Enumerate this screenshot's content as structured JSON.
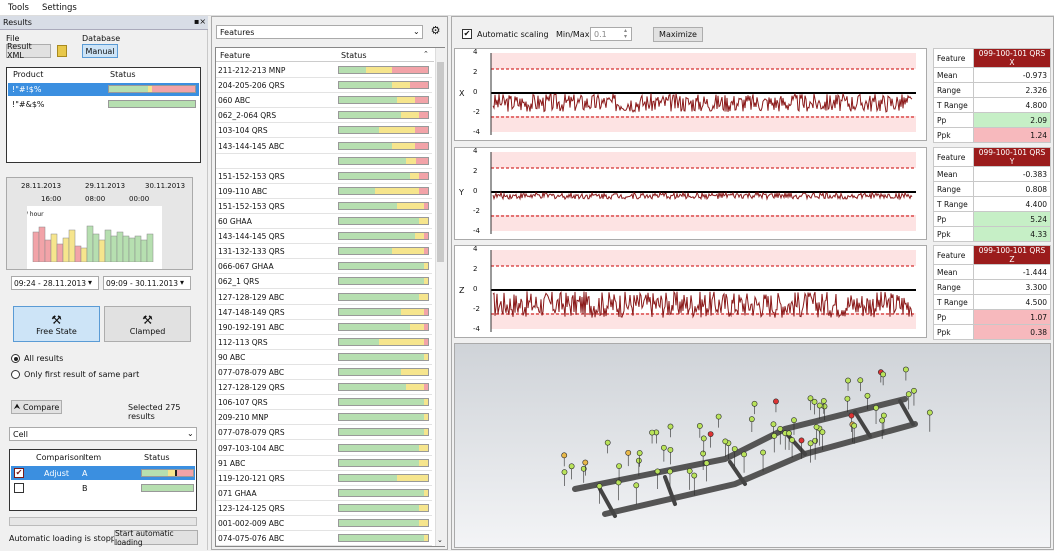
{
  "menu": {
    "tools": "Tools",
    "settings": "Settings"
  },
  "results": {
    "header": "Results",
    "file_label": "File",
    "database_label": "Database",
    "result_xml": "Result XML",
    "manual": "Manual",
    "products_headers": [
      "Product",
      "Status"
    ],
    "products": [
      {
        "name": "!\"#!$%",
        "status": [
          [
            0.45,
            "g"
          ],
          [
            0.05,
            "y"
          ],
          [
            0.5,
            "r"
          ]
        ]
      },
      {
        "name": "!\"#&$%",
        "status": [
          [
            1,
            "g"
          ]
        ]
      }
    ],
    "dates": [
      "28.11.2013",
      "29.11.2013",
      "30.11.2013"
    ],
    "times": [
      "16:00",
      "08:00",
      "00:00"
    ],
    "parts_label": "Parts / hour",
    "y_ticks": [
      "20",
      "10",
      "0"
    ],
    "from": "09:24 - 28.11.2013",
    "to": "09:09 - 30.11.2013",
    "free_state": "Free State",
    "clamped": "Clamped",
    "radio_all": "All results",
    "radio_first": "Only first result of same part",
    "compare": "Compare",
    "selected": "Selected 275 results",
    "cell": "Cell",
    "cmp_headers": [
      "Comparison",
      "Item",
      "Status"
    ],
    "cmp_rows": [
      {
        "name": "Adjust",
        "item": "A"
      },
      {
        "name": "",
        "item": "B"
      }
    ],
    "auto_loading_text": "Automatic loading is stopped",
    "start_auto": "Start automatic loading"
  },
  "features": {
    "dropdown": "Features",
    "headers": [
      "Feature",
      "Status"
    ],
    "rows": [
      {
        "name": "211-212-213 MNP",
        "s": [
          [
            0.3,
            "g"
          ],
          [
            0.3,
            "y"
          ],
          [
            0.4,
            "r"
          ]
        ]
      },
      {
        "name": "204-205-206 QRS",
        "s": [
          [
            0.6,
            "g"
          ],
          [
            0.2,
            "y"
          ],
          [
            0.2,
            "r"
          ]
        ]
      },
      {
        "name": "060 ABC",
        "s": [
          [
            0.65,
            "g"
          ],
          [
            0.2,
            "y"
          ],
          [
            0.15,
            "r"
          ]
        ]
      },
      {
        "name": "062_2-064 QRS",
        "s": [
          [
            0.7,
            "g"
          ],
          [
            0.2,
            "y"
          ],
          [
            0.1,
            "r"
          ]
        ]
      },
      {
        "name": "103-104 QRS",
        "s": [
          [
            0.45,
            "g"
          ],
          [
            0.4,
            "y"
          ],
          [
            0.15,
            "r"
          ]
        ]
      },
      {
        "name": "143-144-145 ABC",
        "s": [
          [
            0.6,
            "g"
          ],
          [
            0.25,
            "y"
          ],
          [
            0.15,
            "r"
          ]
        ]
      },
      {
        "name": "099-100-101 QRS",
        "s": [
          [
            0.75,
            "g"
          ],
          [
            0.12,
            "y"
          ],
          [
            0.13,
            "r"
          ]
        ]
      },
      {
        "name": "151-152-153 QRS",
        "s": [
          [
            0.8,
            "g"
          ],
          [
            0.1,
            "y"
          ],
          [
            0.1,
            "r"
          ]
        ]
      },
      {
        "name": "109-110 ABC",
        "s": [
          [
            0.4,
            "g"
          ],
          [
            0.5,
            "y"
          ],
          [
            0.1,
            "r"
          ]
        ]
      },
      {
        "name": "151-152-153 QRS",
        "s": [
          [
            0.65,
            "g"
          ],
          [
            0.3,
            "y"
          ],
          [
            0.05,
            "r"
          ]
        ]
      },
      {
        "name": "60 GHAA",
        "s": [
          [
            0.9,
            "g"
          ],
          [
            0.1,
            "y"
          ]
        ]
      },
      {
        "name": "143-144-145 QRS",
        "s": [
          [
            0.85,
            "g"
          ],
          [
            0.1,
            "y"
          ],
          [
            0.05,
            "r"
          ]
        ]
      },
      {
        "name": "131-132-133 QRS",
        "s": [
          [
            0.6,
            "g"
          ],
          [
            0.35,
            "y"
          ],
          [
            0.05,
            "r"
          ]
        ]
      },
      {
        "name": "066-067  GHAA",
        "s": [
          [
            0.95,
            "g"
          ],
          [
            0.05,
            "y"
          ]
        ]
      },
      {
        "name": "062_1 QRS",
        "s": [
          [
            0.95,
            "g"
          ],
          [
            0.05,
            "y"
          ]
        ]
      },
      {
        "name": "127-128-129 ABC",
        "s": [
          [
            0.9,
            "g"
          ],
          [
            0.1,
            "y"
          ]
        ]
      },
      {
        "name": "147-148-149 QRS",
        "s": [
          [
            0.7,
            "g"
          ],
          [
            0.25,
            "y"
          ],
          [
            0.05,
            "r"
          ]
        ]
      },
      {
        "name": "190-192-191 ABC",
        "s": [
          [
            0.8,
            "g"
          ],
          [
            0.15,
            "y"
          ],
          [
            0.05,
            "r"
          ]
        ]
      },
      {
        "name": "112-113 QRS",
        "s": [
          [
            0.45,
            "g"
          ],
          [
            0.5,
            "y"
          ],
          [
            0.05,
            "r"
          ]
        ]
      },
      {
        "name": "90 ABC",
        "s": [
          [
            0.95,
            "g"
          ],
          [
            0.05,
            "y"
          ]
        ]
      },
      {
        "name": "077-078-079 ABC",
        "s": [
          [
            0.7,
            "g"
          ],
          [
            0.3,
            "y"
          ]
        ]
      },
      {
        "name": "127-128-129 QRS",
        "s": [
          [
            0.75,
            "g"
          ],
          [
            0.2,
            "y"
          ],
          [
            0.05,
            "r"
          ]
        ]
      },
      {
        "name": "106-107 QRS",
        "s": [
          [
            0.95,
            "g"
          ],
          [
            0.05,
            "y"
          ]
        ]
      },
      {
        "name": "209-210 MNP",
        "s": [
          [
            0.95,
            "g"
          ],
          [
            0.05,
            "y"
          ]
        ]
      },
      {
        "name": "077-078-079 QRS",
        "s": [
          [
            0.95,
            "g"
          ],
          [
            0.05,
            "y"
          ]
        ]
      },
      {
        "name": "097-103-104 ABC",
        "s": [
          [
            0.9,
            "g"
          ],
          [
            0.1,
            "y"
          ]
        ]
      },
      {
        "name": "91 ABC",
        "s": [
          [
            0.9,
            "g"
          ],
          [
            0.1,
            "y"
          ]
        ]
      },
      {
        "name": "119-120-121 QRS",
        "s": [
          [
            0.65,
            "g"
          ],
          [
            0.35,
            "y"
          ]
        ]
      },
      {
        "name": "071 GHAA",
        "s": [
          [
            0.95,
            "g"
          ],
          [
            0.05,
            "y"
          ]
        ]
      },
      {
        "name": "123-124-125 QRS",
        "s": [
          [
            0.9,
            "g"
          ],
          [
            0.1,
            "y"
          ]
        ]
      },
      {
        "name": "001-002-009 ABC",
        "s": [
          [
            0.9,
            "g"
          ],
          [
            0.1,
            "y"
          ]
        ]
      },
      {
        "name": "074-075-076 ABC",
        "s": [
          [
            0.95,
            "g"
          ],
          [
            0.05,
            "y"
          ]
        ]
      }
    ]
  },
  "analysis": {
    "auto_scaling": "Automatic scaling",
    "minmax_label": "Min/Max",
    "minmax_value": "0.1",
    "maximize": "Maximize",
    "y_ticks": [
      "4",
      "2",
      "0",
      "-2",
      "-4"
    ],
    "plots": [
      {
        "axis": "X",
        "stats": {
          "title": "099-100-101 QRS X",
          "mean": "-0.973",
          "range": "2.326",
          "trange": "4.800",
          "pp": "2.09",
          "ppk": "1.24"
        },
        "pp_ok": true,
        "ppk_ok": false
      },
      {
        "axis": "Y",
        "stats": {
          "title": "099-100-101 QRS Y",
          "mean": "-0.383",
          "range": "0.808",
          "trange": "4.400",
          "pp": "5.24",
          "ppk": "4.33"
        },
        "pp_ok": true,
        "ppk_ok": true
      },
      {
        "axis": "Z",
        "stats": {
          "title": "099-100-101 QRS Z",
          "mean": "-1.444",
          "range": "3.300",
          "trange": "4.500",
          "pp": "1.07",
          "ppk": "0.38"
        },
        "pp_ok": false,
        "ppk_ok": false
      }
    ],
    "stat_labels": {
      "feature": "Feature",
      "mean": "Mean",
      "range": "Range",
      "trange": "T Range",
      "pp": "Pp",
      "ppk": "Ppk"
    }
  }
}
